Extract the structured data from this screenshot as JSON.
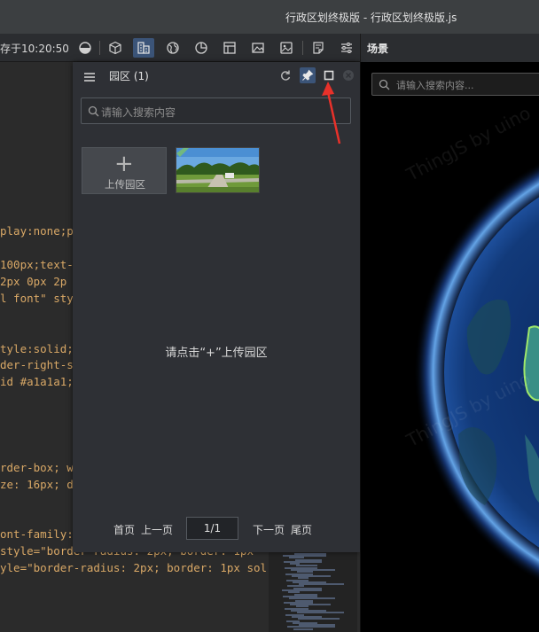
{
  "window": {
    "title": "行政区划终极版 - 行政区划终极版.js"
  },
  "toolbar": {
    "saved_text": "存于10:20:50",
    "icons": [
      "half-circle-icon",
      "cube-icon",
      "building-icon",
      "globe-icon",
      "pie-chart-icon",
      "layout-icon",
      "image-icon",
      "picture-icon",
      "note-icon",
      "settings-sliders-icon"
    ],
    "active_icon": "building-icon"
  },
  "scene": {
    "tab_label": "场景",
    "search_placeholder": "请输入搜索内容...",
    "watermark": "ThingJS by uino"
  },
  "editor": {
    "lines": [
      {
        "text": "play:none;pa"
      },
      {
        "text": "100px;text-"
      },
      {
        "text": " 2px 0px 2p"
      },
      {
        "text": "l font\" sty"
      },
      {
        "text": "tyle:solid;"
      },
      {
        "text": "der-right-s"
      },
      {
        "text": "id #a1a1a1;"
      },
      {
        "text": "rder-box; w"
      },
      {
        "text": "ze: 16px; d"
      },
      {
        "text": "ont-family:"
      },
      {
        "text": " style=\"border-radius: 2px; border: 1px"
      },
      {
        "text": "yle=\"border-radius: 2px; border: 1px sol"
      }
    ]
  },
  "panel": {
    "title": "园区  (1)",
    "search_placeholder": "请输入搜索内容",
    "upload_label": "上传园区",
    "empty_hint": "请点击“+”上传园区",
    "pager": {
      "first": "首页",
      "prev": "上一页",
      "page": "1/1",
      "next": "下一页",
      "last": "尾页"
    }
  },
  "colors": {
    "accent_active": "#3b5478",
    "annotation_arrow": "#e8312a",
    "panel_bg": "#2e3035",
    "code_text": "#d9a866"
  }
}
